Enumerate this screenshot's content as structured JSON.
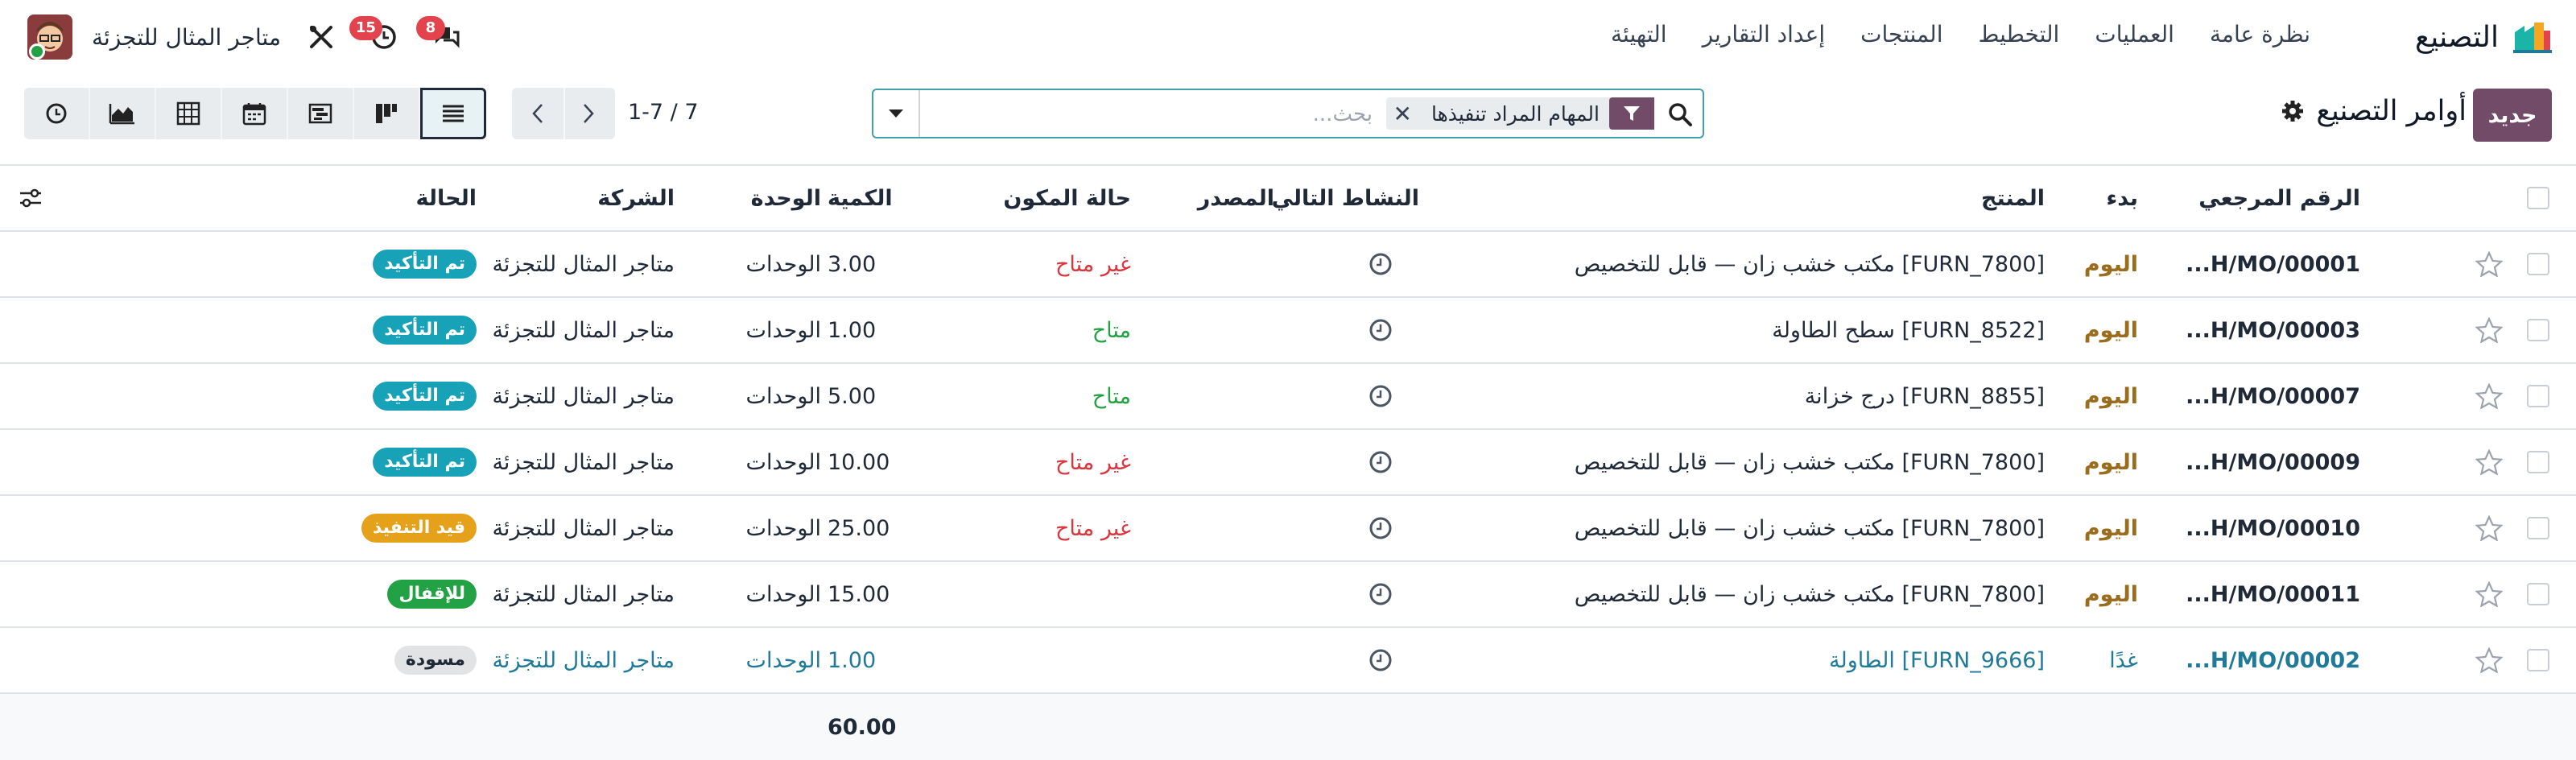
{
  "navbar": {
    "app_name": "التصنيع",
    "menu": [
      "نظرة عامة",
      "العمليات",
      "التخطيط",
      "المنتجات",
      "إعداد التقارير",
      "التهيئة"
    ],
    "company": "متاجر المثال للتجزئة",
    "activity_count": "15",
    "message_count": "8"
  },
  "control": {
    "new_button": "جديد",
    "title": "أوامر التصنيع",
    "facet_label": "المهام المراد تنفيذها",
    "search_placeholder": "بحث...",
    "pager_value": "1-7 / 7"
  },
  "views": [
    "list",
    "kanban",
    "gantt",
    "calendar",
    "pivot",
    "graph",
    "activity"
  ],
  "columns": {
    "reference": "الرقم المرجعي",
    "start": "بدء",
    "product": "المنتج",
    "next_activity": "النشاط التالي",
    "source": "المصدر",
    "component_status": "حالة المكون",
    "quantity": "الكمية",
    "uom": "الوحدة",
    "company": "الشركة",
    "state": "الحالة"
  },
  "rows": [
    {
      "reference": "H/MO/00001...",
      "start": "اليوم",
      "product": "[FURN_7800] مكتب خشب زان — قابل للتخصيص",
      "source": "",
      "component_status": "غير متاح",
      "component_ok": false,
      "quantity": "3.00",
      "uom": "الوحدات",
      "company": "متاجر المثال للتجزئة",
      "state": "تم التأكيد",
      "state_color": "#17a2b8",
      "draft": false
    },
    {
      "reference": "H/MO/00003...",
      "start": "اليوم",
      "product": "[FURN_8522] سطح الطاولة",
      "source": "",
      "component_status": "متاح",
      "component_ok": true,
      "quantity": "1.00",
      "uom": "الوحدات",
      "company": "متاجر المثال للتجزئة",
      "state": "تم التأكيد",
      "state_color": "#17a2b8",
      "draft": false
    },
    {
      "reference": "H/MO/00007...",
      "start": "اليوم",
      "product": "[FURN_8855] درج خزانة",
      "source": "",
      "component_status": "متاح",
      "component_ok": true,
      "quantity": "5.00",
      "uom": "الوحدات",
      "company": "متاجر المثال للتجزئة",
      "state": "تم التأكيد",
      "state_color": "#17a2b8",
      "draft": false
    },
    {
      "reference": "H/MO/00009...",
      "start": "اليوم",
      "product": "[FURN_7800] مكتب خشب زان — قابل للتخصيص",
      "source": "",
      "component_status": "غير متاح",
      "component_ok": false,
      "quantity": "10.00",
      "uom": "الوحدات",
      "company": "متاجر المثال للتجزئة",
      "state": "تم التأكيد",
      "state_color": "#17a2b8",
      "draft": false
    },
    {
      "reference": "H/MO/00010...",
      "start": "اليوم",
      "product": "[FURN_7800] مكتب خشب زان — قابل للتخصيص",
      "source": "",
      "component_status": "غير متاح",
      "component_ok": false,
      "quantity": "25.00",
      "uom": "الوحدات",
      "company": "متاجر المثال للتجزئة",
      "state": "قيد التنفيذ",
      "state_color": "#e6a11a",
      "draft": false
    },
    {
      "reference": "H/MO/00011...",
      "start": "اليوم",
      "product": "[FURN_7800] مكتب خشب زان — قابل للتخصيص",
      "source": "",
      "component_status": "",
      "component_ok": true,
      "quantity": "15.00",
      "uom": "الوحدات",
      "company": "متاجر المثال للتجزئة",
      "state": "للإقفال",
      "state_color": "#22a244",
      "draft": false
    },
    {
      "reference": "H/MO/00002...",
      "start": "غدًا",
      "product": "[FURN_9666] الطاولة",
      "source": "",
      "component_status": "",
      "component_ok": true,
      "quantity": "1.00",
      "uom": "الوحدات",
      "company": "متاجر المثال للتجزئة",
      "state": "مسودة",
      "state_color": "#e2e3e5",
      "draft": true
    }
  ],
  "totals": {
    "quantity": "60.00"
  },
  "colors": {
    "brand": "#714b67",
    "accent": "#017e84",
    "badge": "#e3434d"
  }
}
